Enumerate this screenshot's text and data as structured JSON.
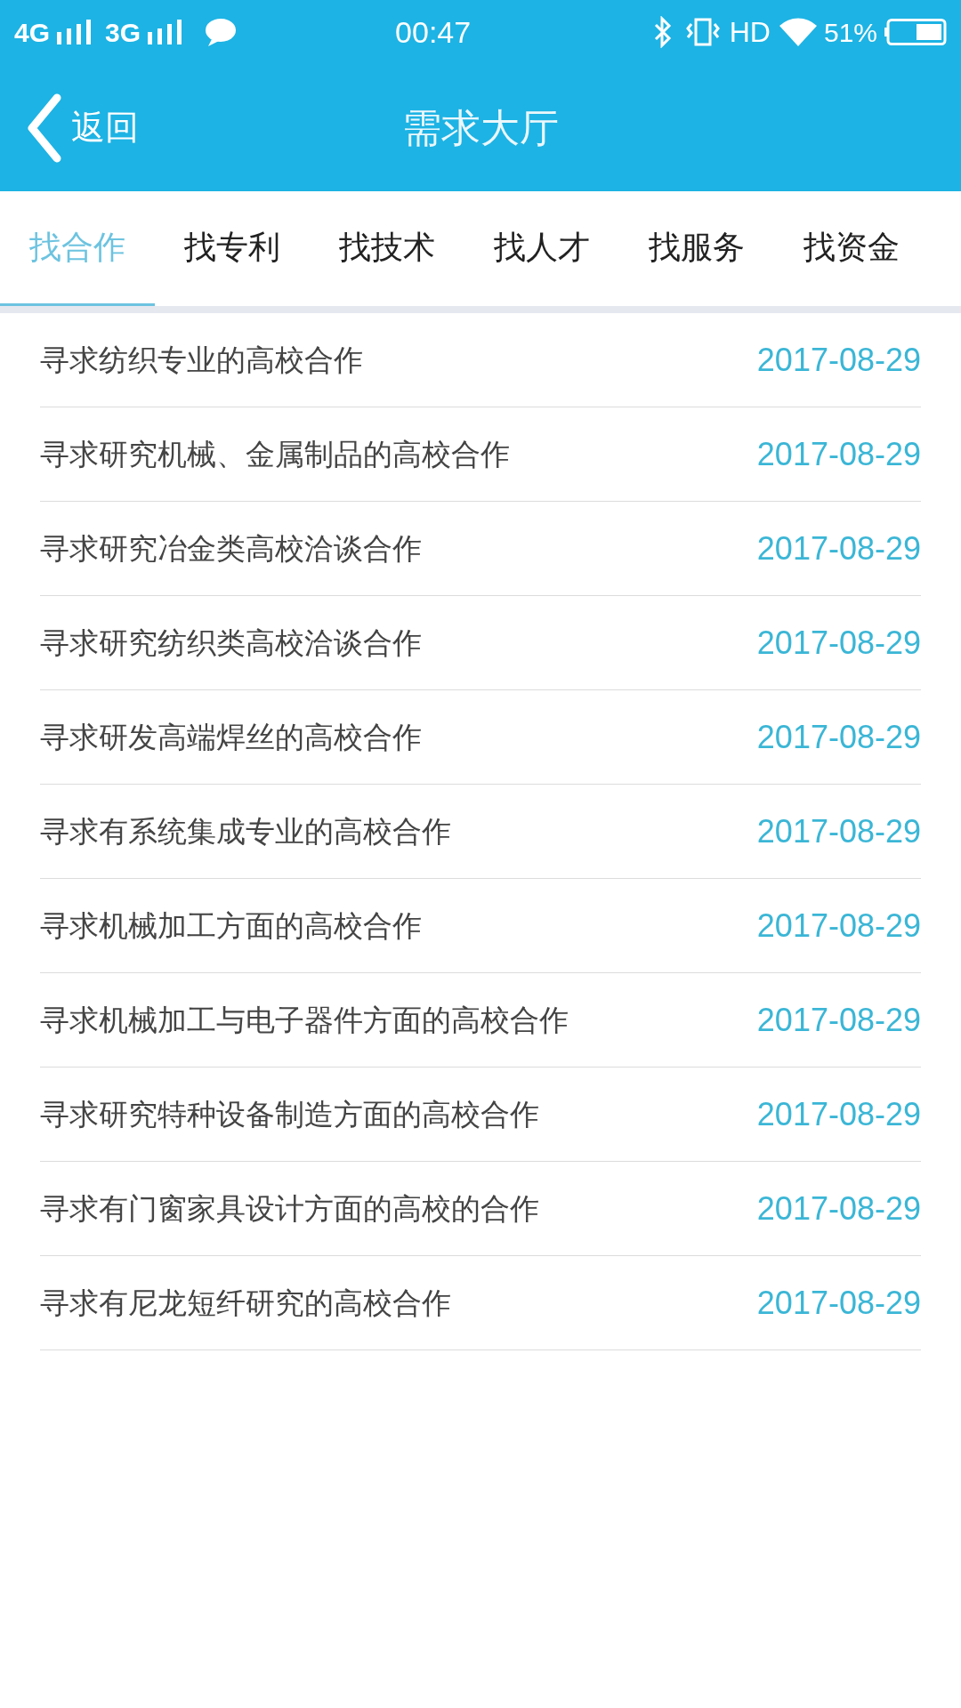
{
  "status_bar": {
    "network_1": "4G",
    "network_2": "3G",
    "time": "00:47",
    "hd": "HD",
    "battery": "51%"
  },
  "header": {
    "back": "返回",
    "title": "需求大厅"
  },
  "tabs": [
    {
      "label": "找合作",
      "selected": true
    },
    {
      "label": "找专利",
      "selected": false
    },
    {
      "label": "找技术",
      "selected": false
    },
    {
      "label": "找人才",
      "selected": false
    },
    {
      "label": "找服务",
      "selected": false
    },
    {
      "label": "找资金",
      "selected": false
    }
  ],
  "items": [
    {
      "title": "寻求纺织专业的高校合作",
      "date": "2017-08-29"
    },
    {
      "title": "寻求研究机械、金属制品的高校合作",
      "date": "2017-08-29"
    },
    {
      "title": "寻求研究冶金类高校洽谈合作",
      "date": "2017-08-29"
    },
    {
      "title": "寻求研究纺织类高校洽谈合作",
      "date": "2017-08-29"
    },
    {
      "title": "寻求研发高端焊丝的高校合作",
      "date": "2017-08-29"
    },
    {
      "title": "寻求有系统集成专业的高校合作",
      "date": "2017-08-29"
    },
    {
      "title": "寻求机械加工方面的高校合作",
      "date": "2017-08-29"
    },
    {
      "title": "寻求机械加工与电子器件方面的高校合作",
      "date": "2017-08-29"
    },
    {
      "title": "寻求研究特种设备制造方面的高校合作",
      "date": "2017-08-29"
    },
    {
      "title": "寻求有门窗家具设计方面的高校的合作",
      "date": "2017-08-29"
    },
    {
      "title": "寻求有尼龙短纤研究的高校合作",
      "date": "2017-08-29"
    }
  ]
}
